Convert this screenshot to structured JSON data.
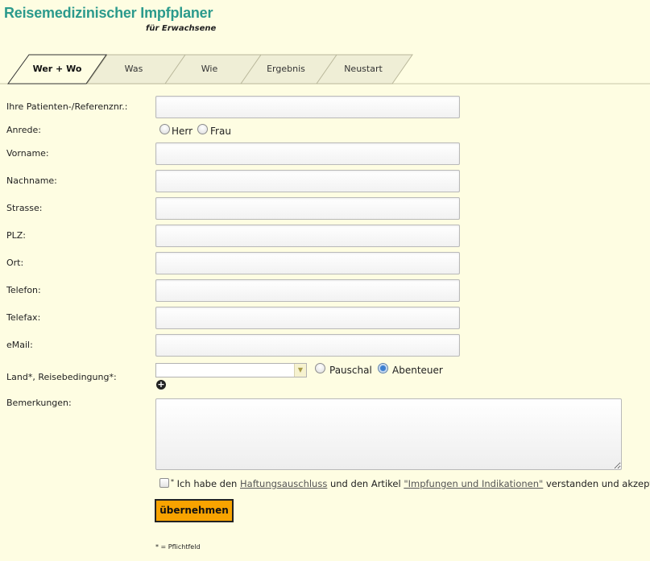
{
  "header": {
    "title": "Reisemedizinischer Impfplaner",
    "subtitle": "für Erwachsene"
  },
  "tabs": [
    {
      "label": "Wer + Wo",
      "active": true
    },
    {
      "label": "Was",
      "active": false
    },
    {
      "label": "Wie",
      "active": false
    },
    {
      "label": "Ergebnis",
      "active": false
    },
    {
      "label": "Neustart",
      "active": false
    }
  ],
  "form": {
    "patient_ref_label": "Ihre Patienten-/Referenznr.:",
    "anrede_label": "Anrede:",
    "anrede_options": [
      "Herr",
      "Frau"
    ],
    "vorname_label": "Vorname:",
    "nachname_label": "Nachname:",
    "strasse_label": "Strasse:",
    "plz_label": "PLZ:",
    "ort_label": "Ort:",
    "telefon_label": "Telefon:",
    "telefax_label": "Telefax:",
    "email_label": "eMail:",
    "land_label": "Land*, Reisebedingung*:",
    "land_value": "",
    "reise_options": [
      "Pauschal",
      "Abenteuer"
    ],
    "reise_selected": "Abenteuer",
    "bemerkungen_label": "Bemerkungen:",
    "consent": {
      "asterisk": "*",
      "text_1": " Ich habe den ",
      "link_1": "Haftungsauschluss",
      "text_2": " und den Artikel ",
      "link_2": "\"Impfungen und Indikationen\"",
      "text_3": " verstanden und akzeptiert."
    },
    "submit_label": "übernehmen",
    "footnote": "* = Pflichtfeld"
  },
  "colors": {
    "background": "#fefde2",
    "title": "#2b9a8c",
    "button": "#f8a300"
  }
}
